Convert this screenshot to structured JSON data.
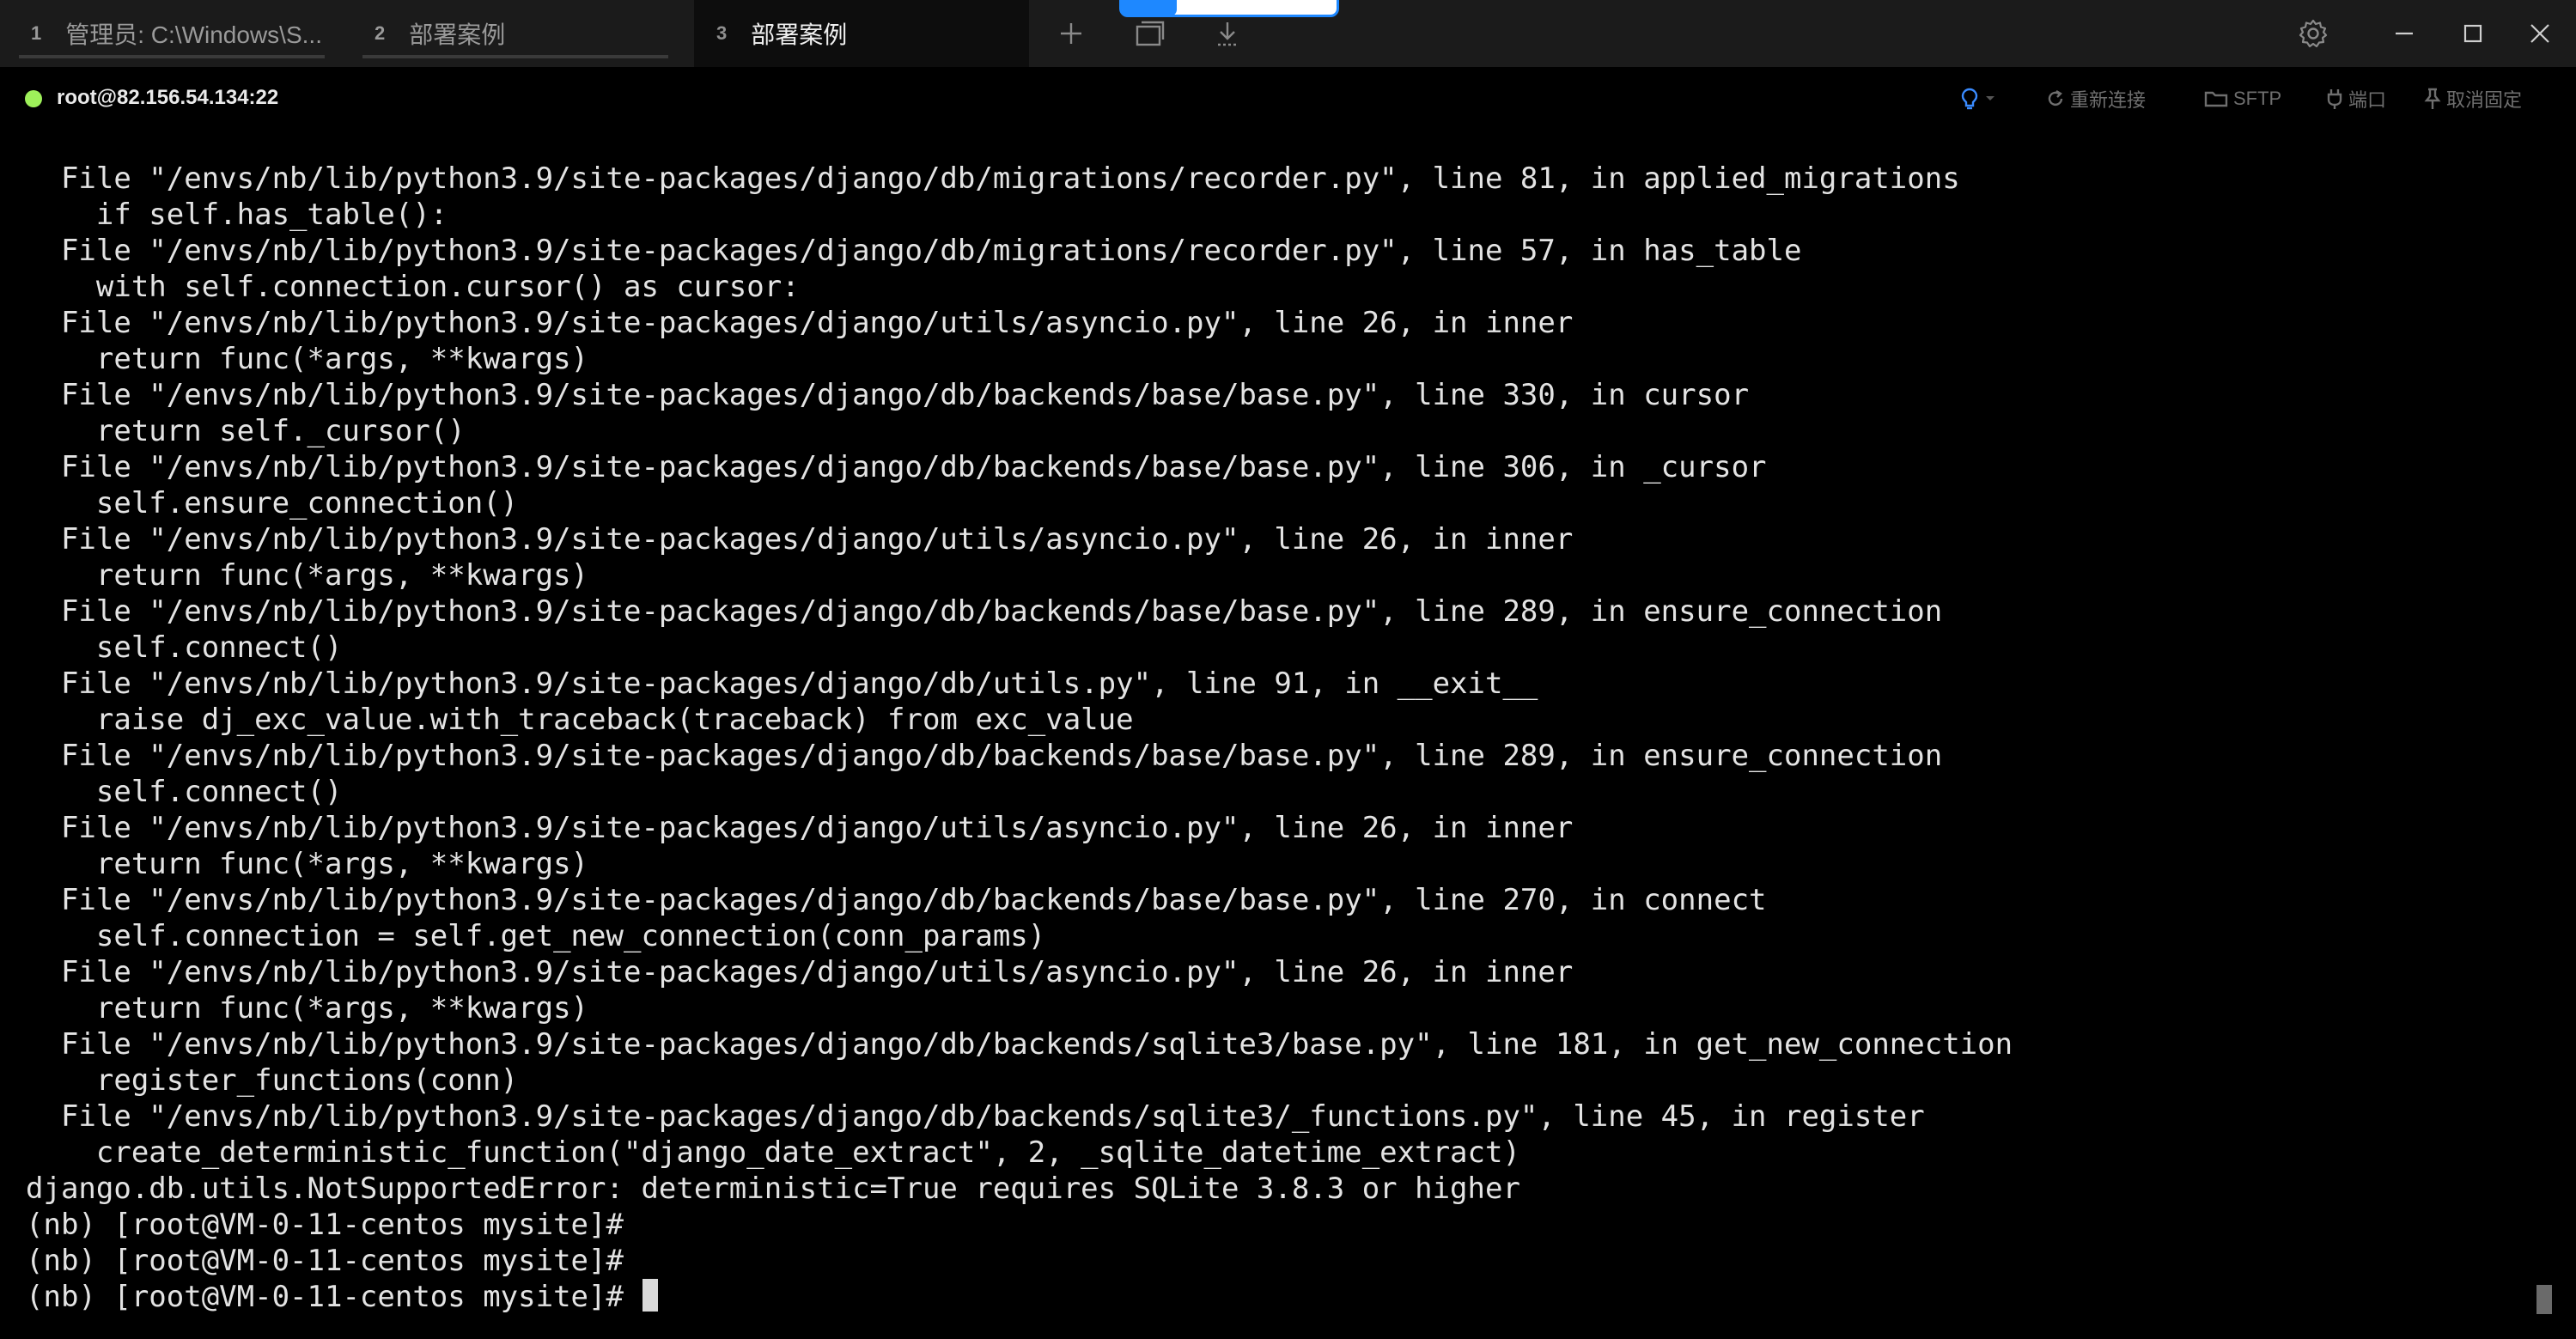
{
  "tabs": [
    {
      "number": "1",
      "title": "管理员: C:\\Windows\\S..."
    },
    {
      "number": "2",
      "title": "部署案例"
    },
    {
      "number": "3",
      "title": "部署案例"
    }
  ],
  "active_tab": 3,
  "session": {
    "host": "root@82.156.54.134:22",
    "status_color": "#9ef05a"
  },
  "toolbar": {
    "reconnect_label": "重新连接",
    "sftp_label": "SFTP",
    "port_label": "端口",
    "unpin_label": "取消固定"
  },
  "colors": {
    "background": "#000000",
    "titlebar": "#1b1b1b",
    "accent": "#1e88ff",
    "text": "#e3e3e3"
  },
  "icons": {
    "new_tab": "plus-icon",
    "duplicate": "window-stack-icon",
    "download": "download-icon",
    "settings": "gear-icon",
    "minimize": "minimize-icon",
    "maximize": "maximize-icon",
    "close": "close-icon",
    "hint": "lightbulb-icon"
  },
  "terminal": {
    "lines": [
      "  File \"/envs/nb/lib/python3.9/site-packages/django/db/migrations/recorder.py\", line 81, in applied_migrations",
      "    if self.has_table():",
      "  File \"/envs/nb/lib/python3.9/site-packages/django/db/migrations/recorder.py\", line 57, in has_table",
      "    with self.connection.cursor() as cursor:",
      "  File \"/envs/nb/lib/python3.9/site-packages/django/utils/asyncio.py\", line 26, in inner",
      "    return func(*args, **kwargs)",
      "  File \"/envs/nb/lib/python3.9/site-packages/django/db/backends/base/base.py\", line 330, in cursor",
      "    return self._cursor()",
      "  File \"/envs/nb/lib/python3.9/site-packages/django/db/backends/base/base.py\", line 306, in _cursor",
      "    self.ensure_connection()",
      "  File \"/envs/nb/lib/python3.9/site-packages/django/utils/asyncio.py\", line 26, in inner",
      "    return func(*args, **kwargs)",
      "  File \"/envs/nb/lib/python3.9/site-packages/django/db/backends/base/base.py\", line 289, in ensure_connection",
      "    self.connect()",
      "  File \"/envs/nb/lib/python3.9/site-packages/django/db/utils.py\", line 91, in __exit__",
      "    raise dj_exc_value.with_traceback(traceback) from exc_value",
      "  File \"/envs/nb/lib/python3.9/site-packages/django/db/backends/base/base.py\", line 289, in ensure_connection",
      "    self.connect()",
      "  File \"/envs/nb/lib/python3.9/site-packages/django/utils/asyncio.py\", line 26, in inner",
      "    return func(*args, **kwargs)",
      "  File \"/envs/nb/lib/python3.9/site-packages/django/db/backends/base/base.py\", line 270, in connect",
      "    self.connection = self.get_new_connection(conn_params)",
      "  File \"/envs/nb/lib/python3.9/site-packages/django/utils/asyncio.py\", line 26, in inner",
      "    return func(*args, **kwargs)",
      "  File \"/envs/nb/lib/python3.9/site-packages/django/db/backends/sqlite3/base.py\", line 181, in get_new_connection",
      "    register_functions(conn)",
      "  File \"/envs/nb/lib/python3.9/site-packages/django/db/backends/sqlite3/_functions.py\", line 45, in register",
      "    create_deterministic_function(\"django_date_extract\", 2, _sqlite_datetime_extract)",
      "django.db.utils.NotSupportedError: deterministic=True requires SQLite 3.8.3 or higher",
      "(nb) [root@VM-0-11-centos mysite]#",
      "(nb) [root@VM-0-11-centos mysite]#"
    ],
    "prompt": "(nb) [root@VM-0-11-centos mysite]# "
  }
}
